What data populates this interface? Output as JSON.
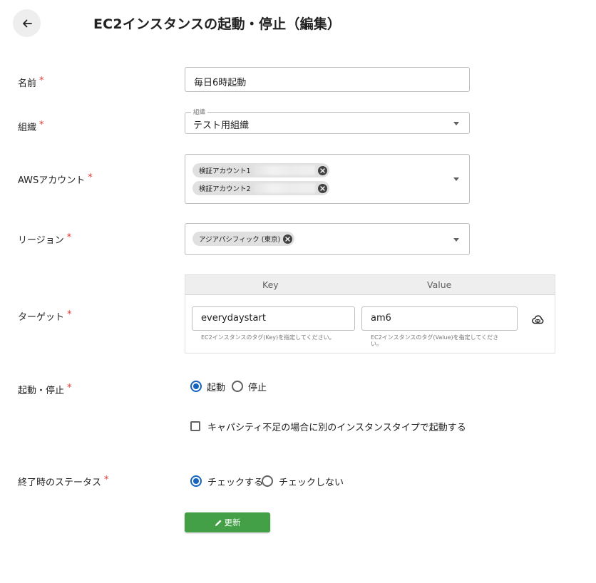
{
  "header": {
    "title": "EC2インスタンスの起動・停止（編集）"
  },
  "required_mark": "*",
  "name": {
    "label": "名前",
    "value": "毎日6時起動"
  },
  "organization": {
    "label": "組織",
    "floating_label": "組織",
    "value": "テスト用組織"
  },
  "aws_account": {
    "label": "AWSアカウント",
    "chips": [
      "検証アカウント1",
      "検証アカウント2"
    ]
  },
  "region": {
    "label": "リージョン",
    "chips": [
      "アジアパシフィック (東京)"
    ]
  },
  "target": {
    "label": "ターゲット",
    "key_header": "Key",
    "value_header": "Value",
    "key_value": "everydaystart",
    "value_value": "am6",
    "key_help": "EC2インスタンスのタグ(Key)を指定してください。",
    "value_help": "EC2インスタンスのタグ(Value)を指定してください。"
  },
  "start_stop": {
    "label": "起動・停止",
    "options": [
      "起動",
      "停止"
    ],
    "selected": "起動"
  },
  "capacity_fallback": {
    "label": "キャパシティ不足の場合に別のインスタンスタイプで起動する",
    "checked": false
  },
  "end_status": {
    "label": "終了時のステータス",
    "options": [
      "チェックする",
      "チェックしない"
    ],
    "selected": "チェックする"
  },
  "actions": {
    "update_label": "更新"
  },
  "colors": {
    "accent": "#1565c0",
    "required": "#e53935",
    "update_button": "#43a047"
  },
  "icons": [
    "arrow-left-icon",
    "chevron-down-icon",
    "chip-close-icon",
    "cloud-eye-icon",
    "pencil-icon"
  ]
}
